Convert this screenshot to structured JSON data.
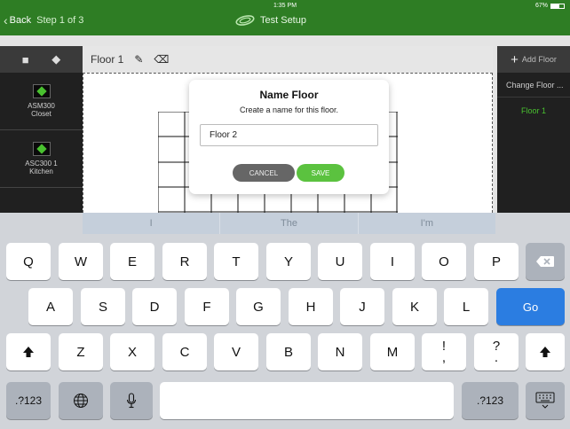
{
  "status": {
    "time": "1:35 PM",
    "battery": "67%",
    "battery_level": 0.67
  },
  "nav": {
    "back_label": "Back",
    "step_label": "Step 1 of 3",
    "title": "Test Setup"
  },
  "left_panel": {
    "devices": [
      {
        "name": "ASM300",
        "location": "Closet"
      },
      {
        "name": "ASC300 1",
        "location": "Kitchen"
      }
    ]
  },
  "toolbar": {
    "floor_name": "Floor 1"
  },
  "right_panel": {
    "add_floor": "Add Floor",
    "change_floor": "Change Floor ...",
    "floors": [
      "Floor 1"
    ]
  },
  "dialog": {
    "title": "Name Floor",
    "message": "Create a name for this floor.",
    "input_value": "Floor 2",
    "cancel_label": "CANCEL",
    "save_label": "SAVE"
  },
  "suggestions": [
    "I",
    "The",
    "I'm"
  ],
  "keyboard": {
    "row1": [
      "Q",
      "W",
      "E",
      "R",
      "T",
      "Y",
      "U",
      "I",
      "O",
      "P"
    ],
    "row2": [
      "A",
      "S",
      "D",
      "F",
      "G",
      "H",
      "J",
      "K",
      "L"
    ],
    "row3": [
      "Z",
      "X",
      "C",
      "V",
      "B",
      "N",
      "M"
    ],
    "row3_punct": [
      [
        "!",
        ","
      ],
      [
        "?",
        "."
      ]
    ],
    "go_label": "Go",
    "numbers_label": ".?123"
  },
  "colors": {
    "nav_bar": "#2e7d24",
    "accent_green": "#5bc23f",
    "go_blue": "#2b7de1"
  }
}
